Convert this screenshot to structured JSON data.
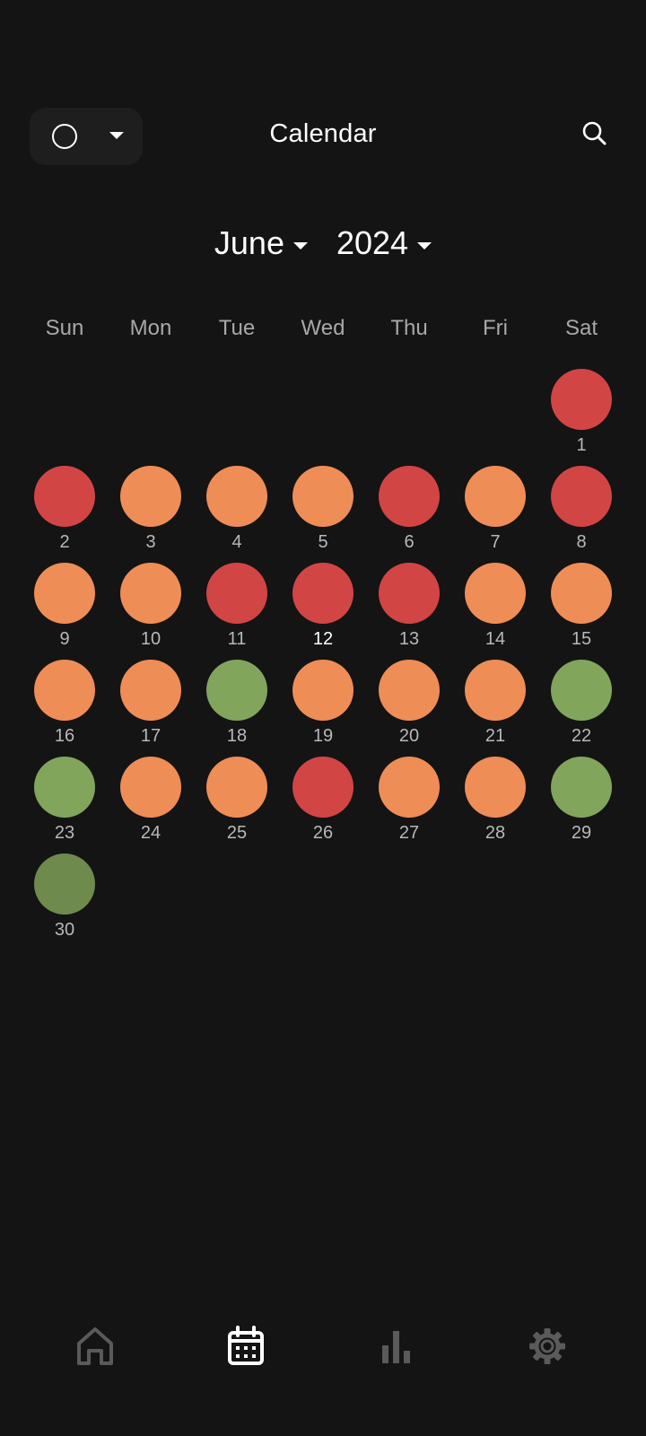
{
  "header": {
    "title": "Calendar",
    "filter_icon": "circle-outline-icon",
    "filter_caret_icon": "caret-down-icon",
    "search_icon": "search-icon"
  },
  "period": {
    "month": "June",
    "year": "2024"
  },
  "weekdays": [
    "Sun",
    "Mon",
    "Tue",
    "Wed",
    "Thu",
    "Fri",
    "Sat"
  ],
  "colors": {
    "background": "#141414",
    "red": "#d24545",
    "orange": "#ef8d56",
    "green": "#82a55c",
    "dark_green": "#6e8a4c",
    "muted_icon": "#5a5a5a",
    "active_icon": "#ffffff"
  },
  "calendar": {
    "first_weekday_index": 6,
    "today": "12",
    "days": [
      {
        "day": "1",
        "mood": "red"
      },
      {
        "day": "2",
        "mood": "red"
      },
      {
        "day": "3",
        "mood": "orange"
      },
      {
        "day": "4",
        "mood": "orange"
      },
      {
        "day": "5",
        "mood": "orange"
      },
      {
        "day": "6",
        "mood": "red"
      },
      {
        "day": "7",
        "mood": "orange"
      },
      {
        "day": "8",
        "mood": "red"
      },
      {
        "day": "9",
        "mood": "orange"
      },
      {
        "day": "10",
        "mood": "orange"
      },
      {
        "day": "11",
        "mood": "red"
      },
      {
        "day": "12",
        "mood": "red"
      },
      {
        "day": "13",
        "mood": "red"
      },
      {
        "day": "14",
        "mood": "orange"
      },
      {
        "day": "15",
        "mood": "orange"
      },
      {
        "day": "16",
        "mood": "orange"
      },
      {
        "day": "17",
        "mood": "orange"
      },
      {
        "day": "18",
        "mood": "green"
      },
      {
        "day": "19",
        "mood": "orange"
      },
      {
        "day": "20",
        "mood": "orange"
      },
      {
        "day": "21",
        "mood": "orange"
      },
      {
        "day": "22",
        "mood": "green"
      },
      {
        "day": "23",
        "mood": "green"
      },
      {
        "day": "24",
        "mood": "orange"
      },
      {
        "day": "25",
        "mood": "orange"
      },
      {
        "day": "26",
        "mood": "red"
      },
      {
        "day": "27",
        "mood": "orange"
      },
      {
        "day": "28",
        "mood": "orange"
      },
      {
        "day": "29",
        "mood": "green"
      },
      {
        "day": "30",
        "mood": "dark_green"
      }
    ]
  },
  "bottom_nav": [
    {
      "name": "home",
      "icon": "home-icon",
      "active": false
    },
    {
      "name": "calendar",
      "icon": "calendar-icon",
      "active": true
    },
    {
      "name": "stats",
      "icon": "bar-chart-icon",
      "active": false
    },
    {
      "name": "settings",
      "icon": "gear-icon",
      "active": false
    }
  ]
}
